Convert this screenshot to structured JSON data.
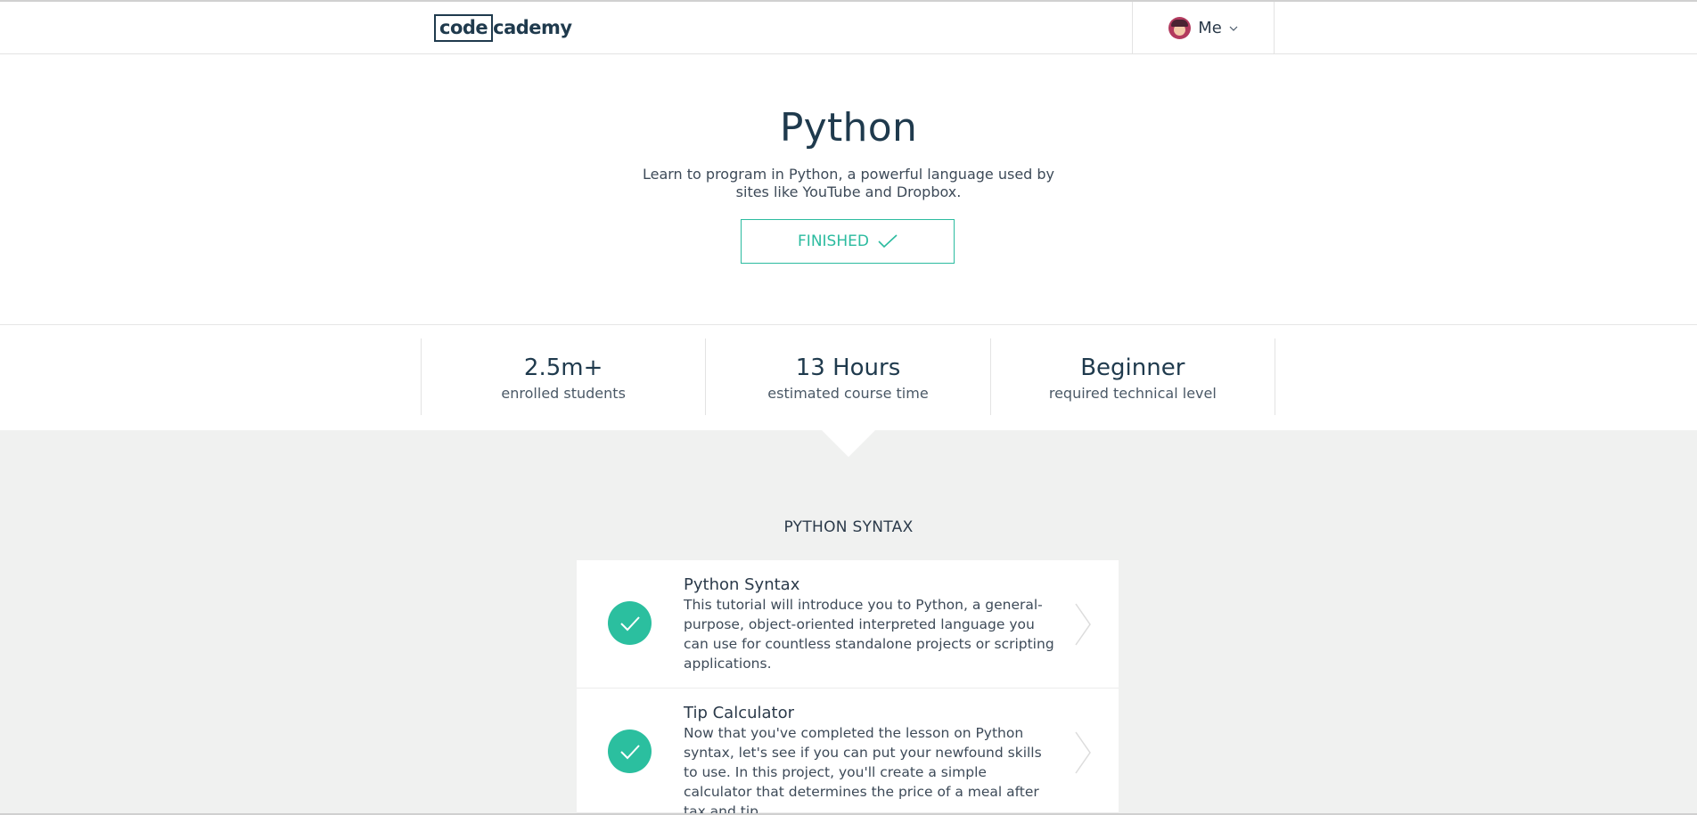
{
  "header": {
    "logo_boxed": "code",
    "logo_rest": "cademy",
    "user_label": "Me"
  },
  "hero": {
    "title": "Python",
    "description": "Learn to program in Python, a powerful language used by sites like YouTube and Dropbox.",
    "status_button": "FINISHED"
  },
  "stats": [
    {
      "value": "2.5m+",
      "label": "enrolled students"
    },
    {
      "value": "13 Hours",
      "label": "estimated course time"
    },
    {
      "value": "Beginner",
      "label": "required technical level"
    }
  ],
  "section": {
    "title": "PYTHON SYNTAX"
  },
  "lessons": [
    {
      "title": "Python Syntax",
      "description": "This tutorial will introduce you to Python, a general-purpose, object-oriented interpreted language you can use for countless standalone projects or scripting applications.",
      "completed": true
    },
    {
      "title": "Tip Calculator",
      "description": "Now that you've completed the lesson on Python syntax, let's see if you can put your newfound skills to use. In this project, you'll create a simple calculator that determines the price of a meal after tax and tip.",
      "completed": true
    }
  ],
  "colors": {
    "accent": "#2bbf9f",
    "navy": "#1f3a4d",
    "grey_bg": "#f0f1f0"
  },
  "icons": {
    "avatar": "user-avatar",
    "dropdown": "chevron-down-icon",
    "finished": "checkmark-icon",
    "lesson_status": "check-circle-icon",
    "lesson_nav": "chevron-right-icon"
  }
}
